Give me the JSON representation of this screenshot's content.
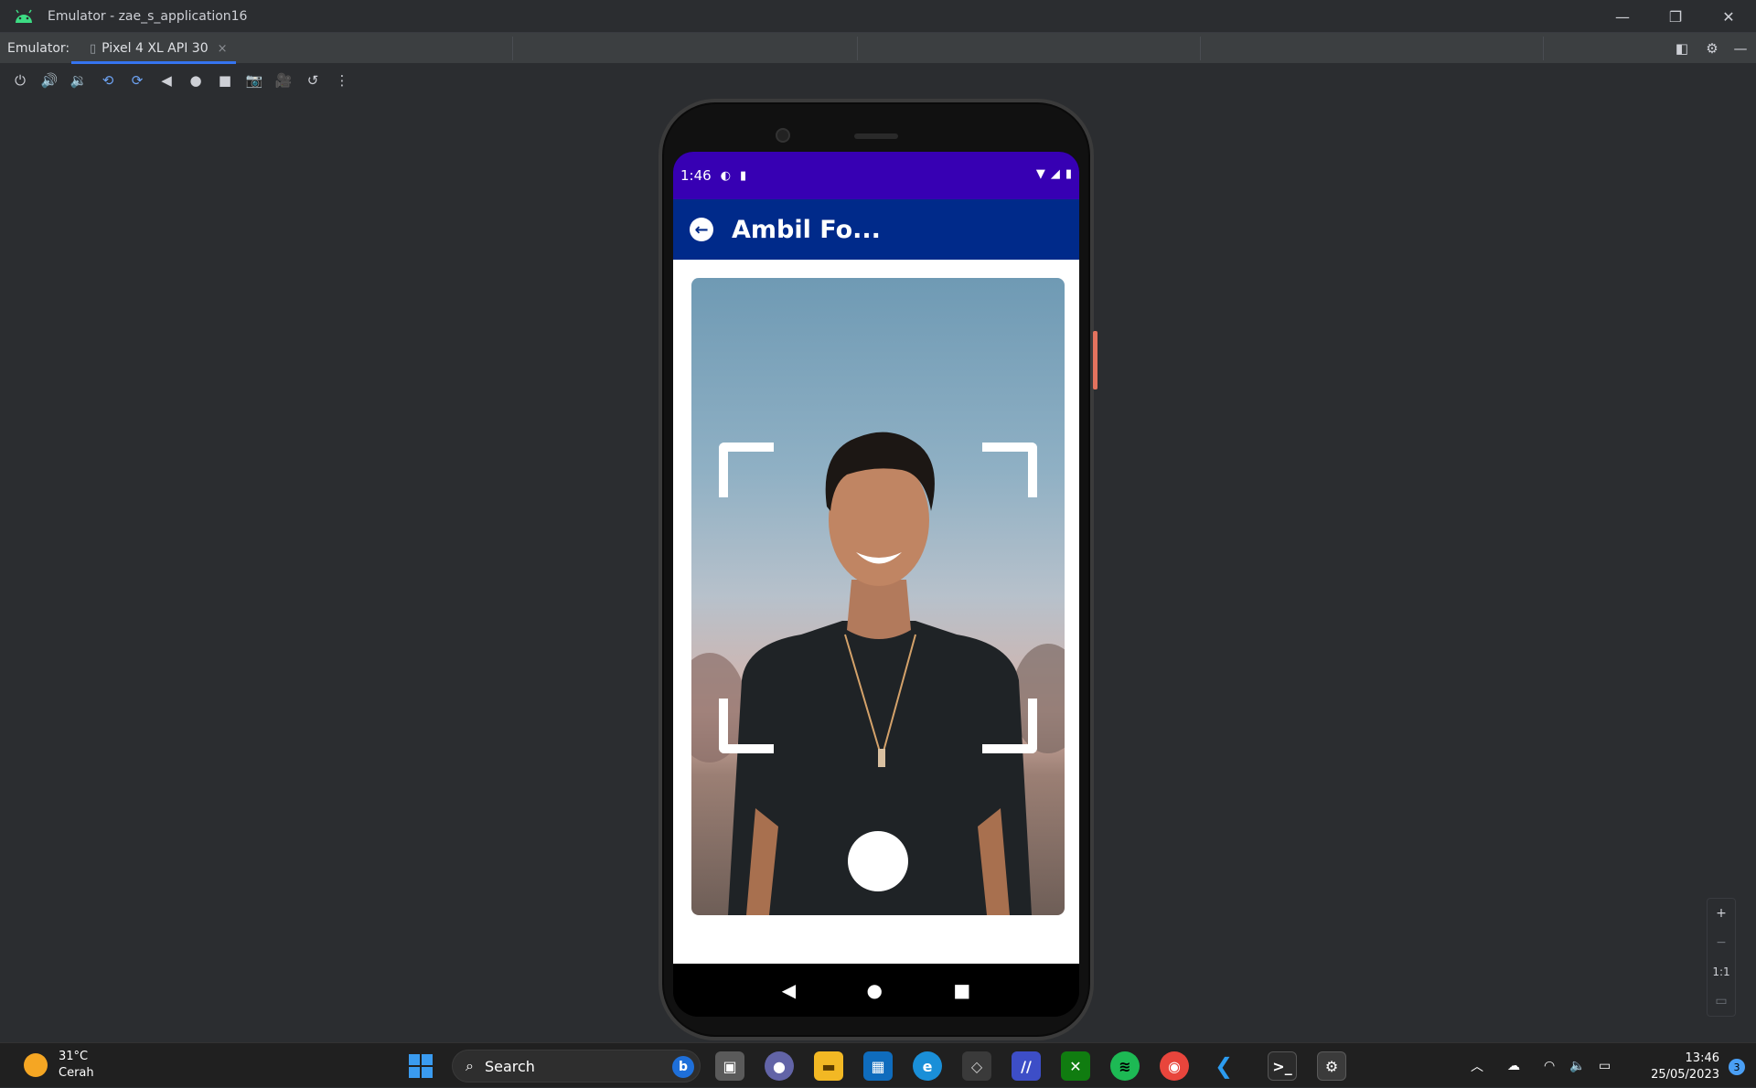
{
  "window": {
    "title": "Emulator - zae_s_application16",
    "controls": [
      "minimize",
      "restore",
      "close"
    ]
  },
  "tabbar": {
    "label": "Emulator:",
    "tab_label": "Pixel 4 XL API 30",
    "tab_close": "×"
  },
  "toolbar": {
    "buttons": [
      "power",
      "volume-up",
      "volume-down",
      "rotate-left",
      "rotate-right",
      "back",
      "home",
      "overview",
      "screenshot",
      "screen-record",
      "snapshot",
      "more"
    ]
  },
  "phone": {
    "status": {
      "time": "1:46"
    },
    "appbar": {
      "title": "Ambil Fo..."
    },
    "camera": {
      "shutter": "shutter-button"
    }
  },
  "zoom": {
    "plus": "+",
    "minus": "−",
    "actual": "1:1"
  },
  "taskbar": {
    "weather_temp": "31°C",
    "weather_desc": "Cerah",
    "search_placeholder": "Search",
    "clock_time": "13:46",
    "clock_date": "25/05/2023",
    "notification_count": "3"
  },
  "colors": {
    "status_bar": "#3700b3",
    "app_bar": "#002a8a",
    "tab_underline": "#3574f0"
  }
}
